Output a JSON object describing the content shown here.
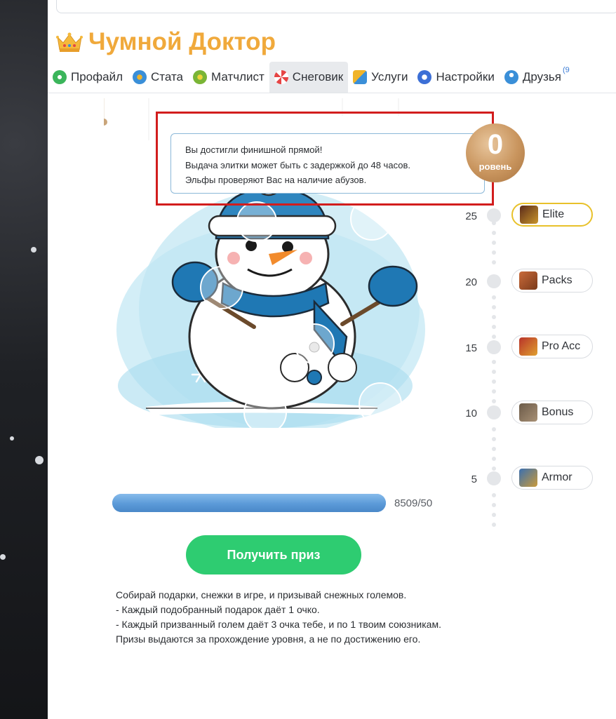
{
  "header": {
    "cut_text": "...",
    "title": "Чумной Доктор"
  },
  "tabs": [
    {
      "label": "Профайл",
      "icon": "profile-icon",
      "color": "#3bb55b"
    },
    {
      "label": "Стата",
      "icon": "stats-icon",
      "color": "#3a8fd8"
    },
    {
      "label": "Матчлист",
      "icon": "matchlist-icon",
      "color": "#7ab536"
    },
    {
      "label": "Снеговик",
      "icon": "candy-icon",
      "color": "#e64545",
      "active": true
    },
    {
      "label": "Услуги",
      "icon": "services-icon",
      "color": "#f0b429"
    },
    {
      "label": "Настройки",
      "icon": "settings-icon",
      "color": "#3c6fd6"
    },
    {
      "label": "Друзья",
      "icon": "friends-icon",
      "color": "#3a8fd8",
      "badge": "(9"
    }
  ],
  "tooltip": {
    "line1": "Вы достигли финишной прямой!",
    "line2": "Выдача элитки может быть с задержкой до 48 часов.",
    "line3": "Эльфы проверяют Вас на наличие абузов."
  },
  "level_ball": {
    "number": "0",
    "label": "ровень"
  },
  "levels": [
    {
      "level": "25",
      "reward": "Elite",
      "icon": "elite-icon",
      "current": true
    },
    {
      "level": "20",
      "reward": "Packs",
      "icon": "packs-icon",
      "current": false
    },
    {
      "level": "15",
      "reward": "Pro Acc",
      "icon": "pro-acc-icon",
      "current": false
    },
    {
      "level": "10",
      "reward": "Bonus",
      "icon": "bonus-icon",
      "current": false
    },
    {
      "level": "5",
      "reward": "Armor",
      "icon": "armor-icon",
      "current": false
    }
  ],
  "progress": {
    "text": "8509/50",
    "fraction": 1.0
  },
  "claim_button": "Получить приз",
  "description": [
    "Собирай подарки, снежки в игре, и призывай снежных големов.",
    "- Каждый подобранный подарок даёт 1 очко.",
    "- Каждый призванный голем даёт 3 очка тебе, и по 1 твоим союзникам.",
    "Призы выдаются за прохождение уровня, а не по достижению его."
  ],
  "colors": {
    "title": "#f0a93b",
    "button": "#2ecc71",
    "highlight": "#d21d1d",
    "progress": "#5b9ad8"
  }
}
